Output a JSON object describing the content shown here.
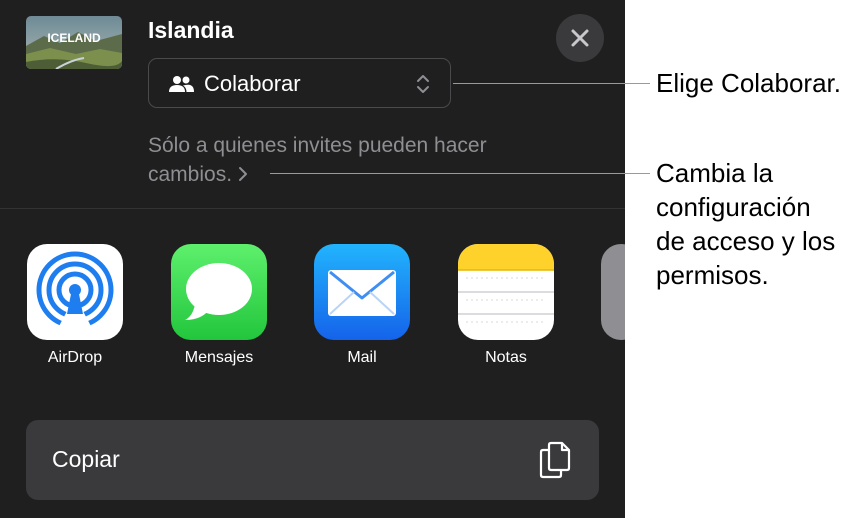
{
  "document": {
    "title": "Islandia",
    "thumbnail_text": "ICELAND"
  },
  "collaborate": {
    "label": "Colaborar",
    "access_text": "Sólo a quienes invites pueden hacer cambios."
  },
  "apps": [
    {
      "name": "AirDrop",
      "icon": "airdrop-icon"
    },
    {
      "name": "Mensajes",
      "icon": "messages-icon"
    },
    {
      "name": "Mail",
      "icon": "mail-icon"
    },
    {
      "name": "Notas",
      "icon": "notes-icon"
    }
  ],
  "copy": {
    "label": "Copiar",
    "icon": "copy-icon"
  },
  "callouts": {
    "choose": "Elige Colaborar.",
    "access_lines": [
      "Cambia la",
      "configuración",
      "de acceso y los",
      "permisos."
    ]
  },
  "colors": {
    "sheet_background": "#1f1f1f",
    "button_background": "#3a3a3c",
    "secondary_text": "#8e8e93"
  }
}
